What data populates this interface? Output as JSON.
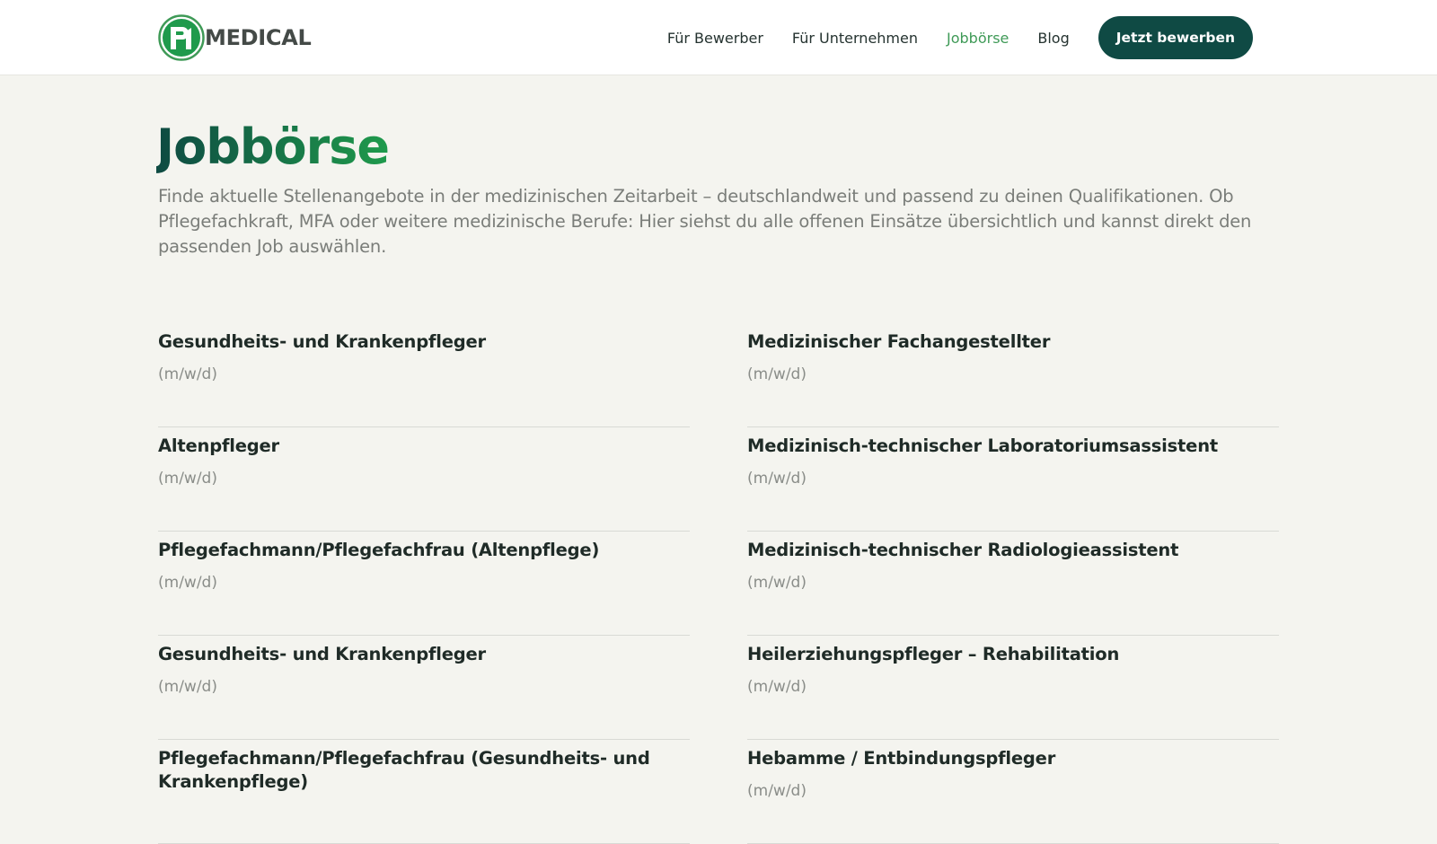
{
  "brand": {
    "mark": "P1",
    "word": "MEDICAL",
    "accent": "#2e9a4e",
    "dark": "#0f4a44"
  },
  "nav": {
    "items": [
      {
        "label": "Für Bewerber",
        "active": false
      },
      {
        "label": "Für Unternehmen",
        "active": false
      },
      {
        "label": "Jobbörse",
        "active": true
      },
      {
        "label": "Blog",
        "active": false
      }
    ],
    "cta_label": "Jetzt bewerben"
  },
  "page": {
    "title": "Jobbörse",
    "intro": "Finde aktuelle Stellenangebote in der medizinischen Zeitarbeit – deutschlandweit und passend zu deinen Qualifikationen. Ob Pflegefachkraft, MFA oder weitere medizinische Berufe: Hier siehst du alle offenen Einsätze übersichtlich und kannst direkt den passenden Job auswählen."
  },
  "jobs": [
    {
      "title": "Gesundheits- und Krankenpfleger",
      "subtitle": "(m/w/d)"
    },
    {
      "title": "Medizinischer Fachangestellter",
      "subtitle": "(m/w/d)"
    },
    {
      "title": "Altenpfleger",
      "subtitle": "(m/w/d)"
    },
    {
      "title": "Medizinisch-technischer Laboratoriumsassistent",
      "subtitle": "(m/w/d)"
    },
    {
      "title": "Pflegefachmann/Pflegefachfrau (Altenpflege)",
      "subtitle": "(m/w/d)"
    },
    {
      "title": "Medizinisch-technischer Radiologieassistent",
      "subtitle": "(m/w/d)"
    },
    {
      "title": "Gesundheits- und Krankenpfleger",
      "subtitle": "(m/w/d)"
    },
    {
      "title": "Heilerziehungspfleger – Rehabilitation",
      "subtitle": "(m/w/d)"
    },
    {
      "title": "Pflegefachmann/Pflegefachfrau (Gesundheits- und Krankenpflege)",
      "subtitle": ""
    },
    {
      "title": "Hebamme / Entbindungspfleger",
      "subtitle": "(m/w/d)"
    }
  ]
}
